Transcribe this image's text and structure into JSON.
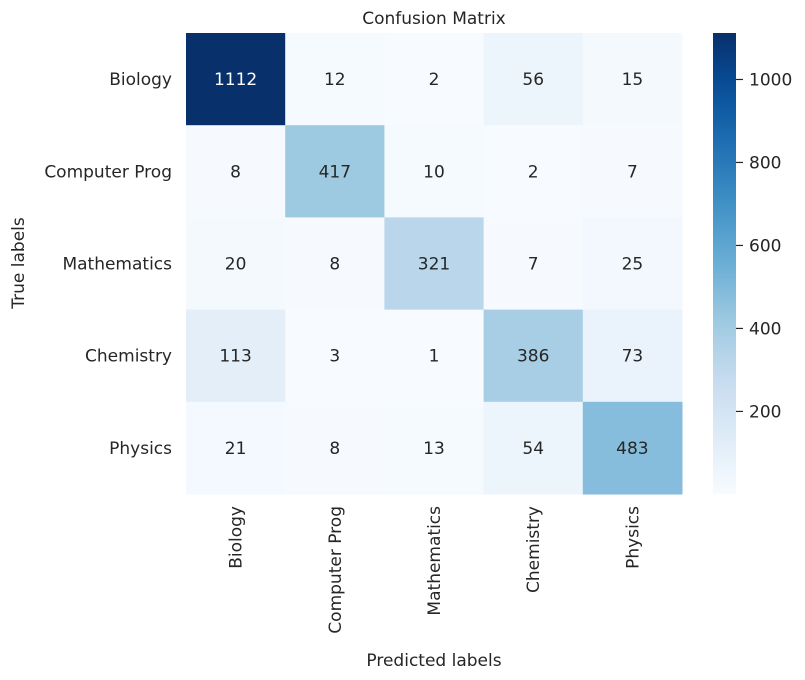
{
  "chart_data": {
    "type": "heatmap",
    "title": "Confusion Matrix",
    "xlabel": "Predicted labels",
    "ylabel": "True labels",
    "x_categories": [
      "Biology",
      "Computer Prog",
      "Mathematics",
      "Chemistry",
      "Physics"
    ],
    "y_categories": [
      "Biology",
      "Computer Prog",
      "Mathematics",
      "Chemistry",
      "Physics"
    ],
    "values": [
      [
        1112,
        12,
        2,
        56,
        15
      ],
      [
        8,
        417,
        10,
        2,
        7
      ],
      [
        20,
        8,
        321,
        7,
        25
      ],
      [
        113,
        3,
        1,
        386,
        73
      ],
      [
        21,
        8,
        13,
        54,
        483
      ]
    ],
    "colormap": "Blues",
    "color_range": [
      1,
      1112
    ],
    "colorbar": {
      "ticks": [
        200,
        400,
        600,
        800,
        1000
      ],
      "tick_labels": [
        "200",
        "400",
        "600",
        "800",
        "1000"
      ],
      "placement": "right"
    },
    "annotations": true,
    "grid": false
  }
}
